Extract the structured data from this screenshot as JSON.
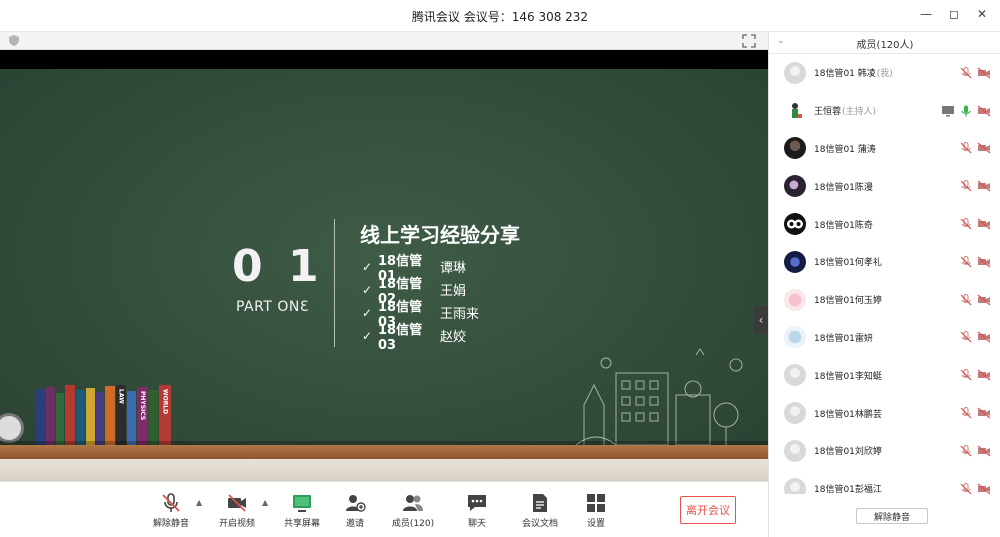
{
  "window": {
    "title": "腾讯会议 会议号：146 308 232"
  },
  "slide": {
    "number_left": "0",
    "number_right": "1",
    "part_label": "PART ONƐ",
    "title": "线上学习经验分享",
    "items": [
      {
        "group": "18信管01",
        "name": "谭琳"
      },
      {
        "group": "18信管02",
        "name": "王娟"
      },
      {
        "group": "18信管03",
        "name": "王雨来"
      },
      {
        "group": "18信管03",
        "name": "赵姣"
      }
    ],
    "books": [
      {
        "color": "#2a3f7a",
        "label": ""
      },
      {
        "color": "#6b2f64",
        "label": ""
      },
      {
        "color": "#2f6a3c",
        "label": ""
      },
      {
        "color": "#b33a2d",
        "label": ""
      },
      {
        "color": "#1c5b78",
        "label": ""
      },
      {
        "color": "#d1a62f",
        "label": ""
      },
      {
        "color": "#4a3a87",
        "label": ""
      },
      {
        "color": "#cf6b27",
        "label": ""
      },
      {
        "color": "#2c2c2c",
        "label": "LAW"
      },
      {
        "color": "#3d6bb2",
        "label": ""
      },
      {
        "color": "#7e2a6b",
        "label": "PHYSICS"
      },
      {
        "color": "#2f5f2a",
        "label": ""
      },
      {
        "color": "#b23b36",
        "label": "WORLD"
      }
    ]
  },
  "toolbar": {
    "unmute": "解除静音",
    "video": "开启视频",
    "share": "共享屏幕",
    "invite": "邀请",
    "members": "成员(120)",
    "chat": "聊天",
    "docs": "会议文档",
    "settings": "设置",
    "leave": "离开会议"
  },
  "panel": {
    "title": "成员(120人)",
    "unmute_all": "解除静音",
    "members": [
      {
        "name": "18信管01 韩凌",
        "role": "(我)",
        "avatar": "placeholder",
        "share": false
      },
      {
        "name": "王恒蓉",
        "role": "(主持人)",
        "avatar": "host",
        "share": true
      },
      {
        "name": "18信管01 蒲涛",
        "role": "",
        "avatar": "dark1",
        "share": false
      },
      {
        "name": "18信管01陈漫",
        "role": "",
        "avatar": "dark2",
        "share": false
      },
      {
        "name": "18信管01陈奇",
        "role": "",
        "avatar": "owl",
        "share": false
      },
      {
        "name": "18信管01何孝礼",
        "role": "",
        "avatar": "blue",
        "share": false
      },
      {
        "name": "18信管01何玉婷",
        "role": "",
        "avatar": "pink",
        "share": false
      },
      {
        "name": "18信管01雷妍",
        "role": "",
        "avatar": "light",
        "share": false
      },
      {
        "name": "18信管01李知蜓",
        "role": "",
        "avatar": "placeholder",
        "share": false
      },
      {
        "name": "18信管01林鹏芸",
        "role": "",
        "avatar": "placeholder",
        "share": false
      },
      {
        "name": "18信管01刘欣婷",
        "role": "",
        "avatar": "placeholder",
        "share": false
      },
      {
        "name": "18信管01彭福江",
        "role": "",
        "avatar": "placeholder",
        "share": false
      }
    ]
  },
  "colors": {
    "slide_bg": "#35503e",
    "leave_red": "#e6534f",
    "mic_green": "#33b34a",
    "muted_red": "#d9534f"
  }
}
